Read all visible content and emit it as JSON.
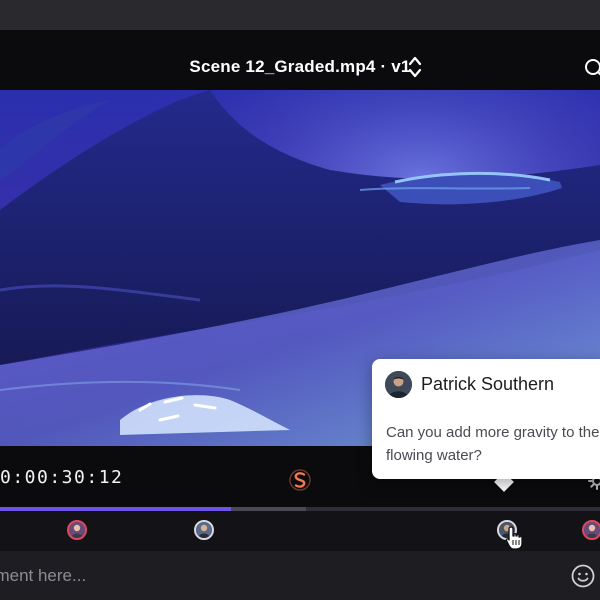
{
  "player": {
    "file_title": "Scene 12_Graded.mp4 · v1",
    "timecode": "0:00:30:12",
    "progress": 0.385,
    "buffered": 0.51
  },
  "comment_bar": {
    "placeholder": "ament here..."
  },
  "comment_popover": {
    "author": "Patrick Southern",
    "text": "Can you add more gravity to the flowing water?"
  },
  "colors": {
    "progress": "#6b55e8",
    "active_marker": "#e0485f",
    "logo": "#f07a55"
  },
  "icons": [
    "chevron-updown-icon",
    "search-icon",
    "app-logo-icon",
    "settings-icon",
    "pointer-hand-icon",
    "emoji-icon"
  ]
}
